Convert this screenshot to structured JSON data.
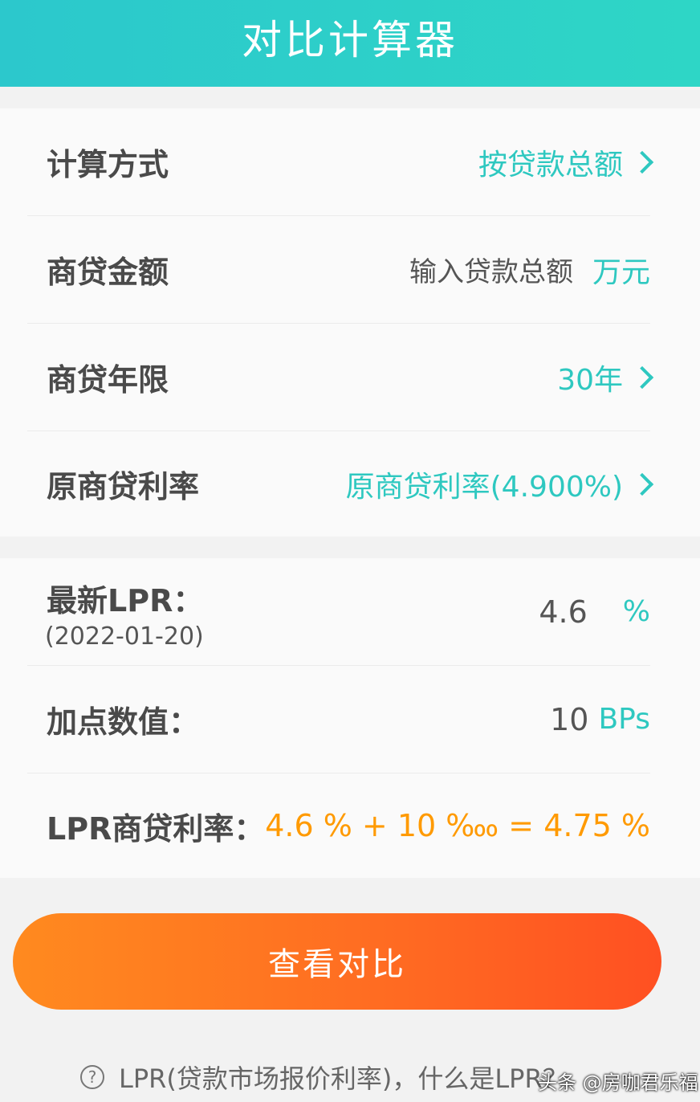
{
  "header": {
    "title": "对比计算器"
  },
  "settings": {
    "method": {
      "label": "计算方式",
      "value": "按贷款总额"
    },
    "amount": {
      "label": "商贷金额",
      "placeholder": "输入贷款总额",
      "unit": "万元"
    },
    "years": {
      "label": "商贷年限",
      "value": "30年"
    },
    "original_rate": {
      "label": "原商贷利率",
      "value": "原商贷利率(4.900%)"
    }
  },
  "lpr": {
    "latest": {
      "label": "最新LPR：",
      "date": "(2022-01-20)",
      "value": "4.6",
      "unit": "%"
    },
    "bp": {
      "label": "加点数值：",
      "value": "10",
      "unit": "BPs"
    },
    "result": {
      "label": "LPR商贷利率：",
      "formula": "4.6 % + 10 ‱ = 4.75 %"
    }
  },
  "button": {
    "label": "查看对比"
  },
  "footer": {
    "help_icon": "question-circle-icon",
    "text": "LPR(贷款市场报价利率)，什么是LPR？"
  },
  "watermark": "头条 @房咖君乐福",
  "colors": {
    "accent": "#2ec8c0",
    "orange": "#ff9a00",
    "button": "#ff6a22"
  }
}
